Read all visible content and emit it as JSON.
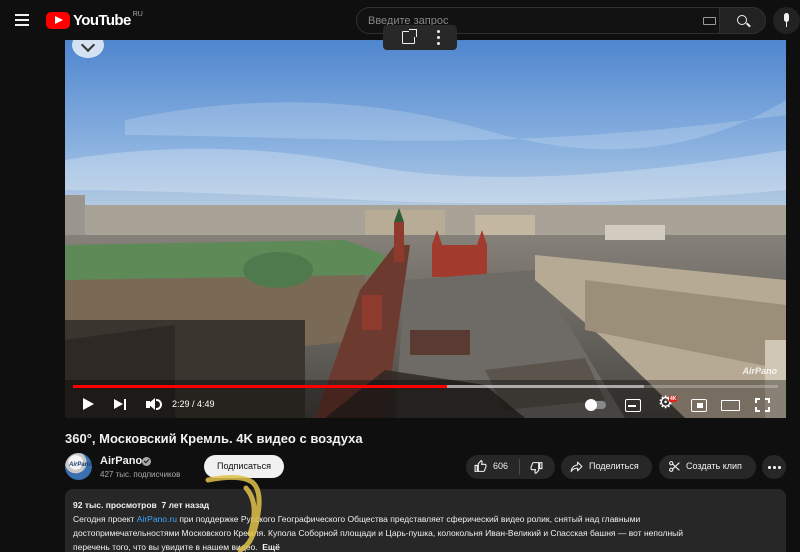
{
  "masthead": {
    "logo_text": "YouTube",
    "logo_country": "RU",
    "search_placeholder": "Введите запрос"
  },
  "player": {
    "watermark": "AirPano",
    "time_current": "2:29",
    "time_total": "4:49",
    "time_display": "2:29 / 4:49",
    "progress_played": 0.53,
    "progress_buffered": 0.81,
    "hd_badge": "4K",
    "autoplay": false
  },
  "video": {
    "title": "360°, Московский Кремль. 4K видео с воздуха"
  },
  "channel": {
    "name": "AirPano",
    "avatar_text": "AirPano",
    "subscribers": "427 тыс. подписчиков",
    "subscribe_label": "Подписаться",
    "verified": true
  },
  "actions": {
    "likes": "606",
    "share_label": "Поделиться",
    "clip_label": "Создать клип"
  },
  "description": {
    "meta": "92 тыс. просмотров  7 лет назад",
    "line1_pre": "Сегодня проект ",
    "line1_link": "AirPano.ru",
    "line1_post": " при поддержке Русского Географического Общества представляет сферический видео ролик, снятый над главными",
    "line2": "достопримечательностями Московского Кремля. Купола Соборной площади и Царь-пушка, колокольня Иван-Великий и Спасская башня — вот неполный",
    "line3": "перечень того, что вы увидите в нашем видео.",
    "more_label": "Ещё"
  },
  "colors": {
    "background": "#0f0f0f",
    "accent_red": "#ff0000",
    "link_blue": "#3ea6ff",
    "pill_bg": "#272727",
    "scribble_yellow": "#e0c24a"
  },
  "icons": {
    "menu": "hamburger-icon",
    "search": "search-icon",
    "keyboard": "keyboard-icon",
    "mic": "mic-icon",
    "share_popover": "open-external-icon",
    "more_popover": "more-vert-icon",
    "play": "play-icon",
    "next": "next-icon",
    "volume": "volume-icon",
    "subtitles": "subtitles-icon",
    "settings": "settings-icon",
    "miniplayer": "miniplayer-icon",
    "theater": "theater-icon",
    "fullscreen": "fullscreen-icon",
    "like": "thumb-up-icon",
    "dislike": "thumb-down-icon",
    "share": "share-arrow-icon",
    "clip": "scissors-icon",
    "more": "more-horiz-icon"
  }
}
